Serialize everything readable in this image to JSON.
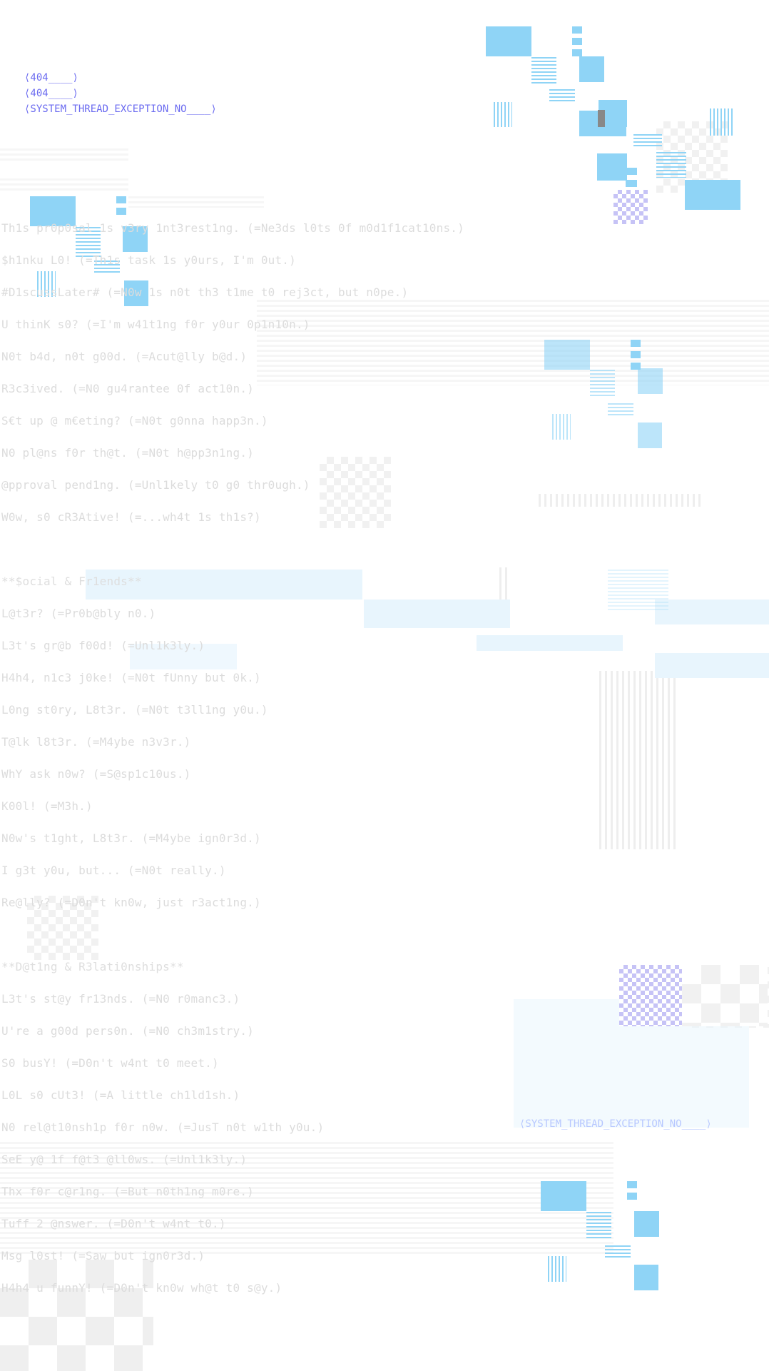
{
  "error_header": [
    "⟨404____⟩",
    "⟨404____⟩",
    "⟨SYSTEM_THREAD_EXCEPTION_NO____⟩"
  ],
  "error_footer": "⟨SYSTEM_THREAD_EXCEPTION_NO____⟩",
  "lines": [
    "Th1s pr0p0sal 1s v3ry 1nt3rest1ng. (=Ne3ds l0ts 0f m0d1f1cat10ns.)",
    "$h1nku L0! (=Th1s task 1s y0urs, I'm 0ut.)",
    "#D1scussLater# (=N0w 1s n0t th3 t1me t0 rej3ct, but n0pe.)",
    "U thinK s0? (=I'm w41t1ng f0r y0ur 0p1n10n.)",
    "N0t b4d, n0t g00d. (=Acut@lly b@d.)",
    "R3c3ived. (=N0 gu4rantee 0f act10n.)",
    "S€t up @ m€eting? (=N0t g0nna happ3n.)",
    "N0 pl@ns f0r th@t. (=N0t h@pp3n1ng.)",
    "@pproval pend1ng. (=Unl1kely t0 g0 thr0ugh.)",
    "W0w, s0 cR3Ative! (=...wh4t 1s th1s?)",
    "",
    "**$ocial & Fr1ends**",
    "L@t3r? (=Pr0b@bly n0.)",
    "L3t's gr@b f00d! (=Unl1k3ly.)",
    "H4h4, n1c3 j0ke! (=N0t fUnny but 0k.)",
    "L0ng st0ry, L8t3r. (=N0t t3ll1ng y0u.)",
    "T@lk l8t3r. (=M4ybe n3v3r.)",
    "WhY ask n0w? (=S@sp1c10us.)",
    "K00l! (=M3h.)",
    "N0w's t1ght, L8t3r. (=M4ybe ign0r3d.)",
    "I g3t y0u, but... (=N0t really.)",
    "Re@lly? (=D0n't kn0w, just r3act1ng.)",
    "",
    "**D@t1ng & R3lati0nships**",
    "L3t's st@y fr13nds. (=N0 r0manc3.)",
    "U're a g00d pers0n. (=N0 ch3m1stry.)",
    "S0 busY! (=D0n't w4nt t0 meet.)",
    "L0L s0 cUt3! (=A little ch1ld1sh.)",
    "N0 rel@t10nsh1p f0r n0w. (=JusT n0t w1th y0u.)",
    "SeE y@ 1f f@t3 @ll0ws. (=Unl1k3ly.)",
    "Thx f0r c@r1ng. (=But n0th1ng m0re.)",
    "Tuff 2 @nswer. (=D0n't w4nt t0.)",
    "Msg l0st! (=Saw but ign0r3d.)",
    "H4h4 u funnY! (=D0n't kn0w wh@t t0 s@y.)"
  ]
}
